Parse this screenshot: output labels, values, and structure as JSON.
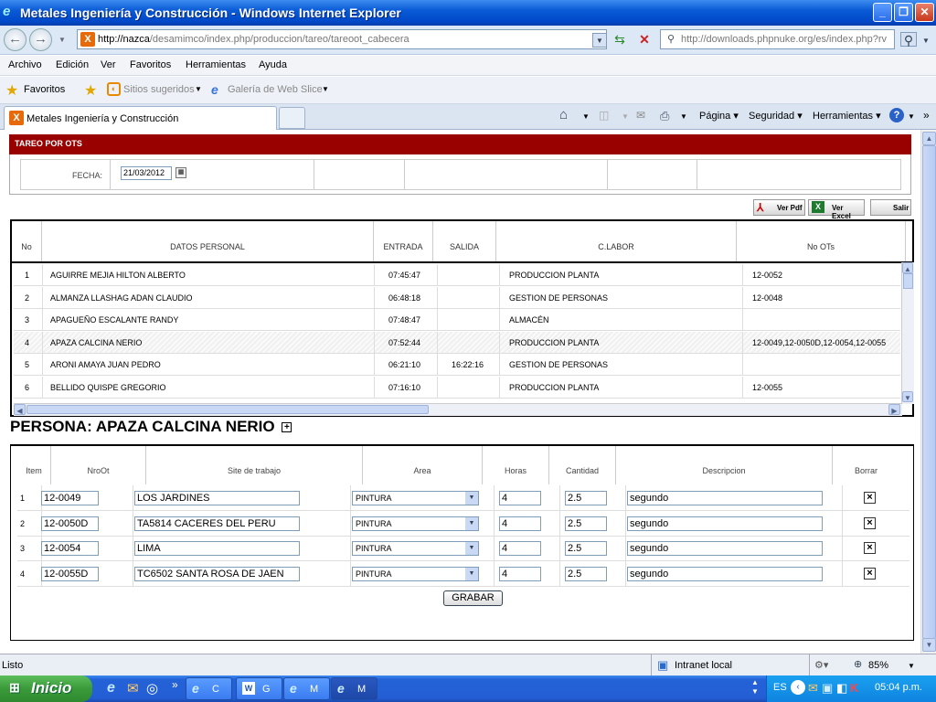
{
  "window": {
    "title": "Metales Ingeniería y Construcción - Windows Internet Explorer"
  },
  "address": {
    "url_host": "http://nazca",
    "url_path": "/desamimco/index.php/produccion/tareo/tareoot_cabecera",
    "search_url": "http://downloads.phpnuke.org/es/index.php?rv"
  },
  "menu": [
    "Archivo",
    "Edición",
    "Ver",
    "Favoritos",
    "Herramientas",
    "Ayuda"
  ],
  "favbar": {
    "favorites": "Favoritos",
    "suggested": "Sitios sugeridos",
    "gallery": "Galería de Web Slice"
  },
  "tab": {
    "title": "Metales Ingeniería y Construcción"
  },
  "toolbar": {
    "page": "Página",
    "security": "Seguridad",
    "tools": "Herramientas"
  },
  "page": {
    "header": "TAREO POR OTS",
    "fecha_label": "FECHA:",
    "fecha_value": "21/03/2012",
    "btn_pdf": "Ver Pdf",
    "btn_excel": "Ver Excel",
    "btn_salir": "Salir",
    "grid1_headers": [
      "No",
      "DATOS PERSONAL",
      "ENTRADA",
      "SALIDA",
      "C.LABOR",
      "No OTs"
    ],
    "personal": [
      {
        "no": "1",
        "nombre": "AGUIRRE MEJIA HILTON ALBERTO",
        "entrada": "07:45:47",
        "salida": "",
        "labor": "PRODUCCION PLANTA",
        "ots": "12-0052"
      },
      {
        "no": "2",
        "nombre": "ALMANZA LLASHAG ADAN CLAUDIO",
        "entrada": "06:48:18",
        "salida": "",
        "labor": "GESTION DE PERSONAS",
        "ots": "12-0048"
      },
      {
        "no": "3",
        "nombre": "APAGUEÑO ESCALANTE RANDY",
        "entrada": "07:48:47",
        "salida": "",
        "labor": "ALMACÉN",
        "ots": ""
      },
      {
        "no": "4",
        "nombre": "APAZA CALCINA NERIO",
        "entrada": "07:52:44",
        "salida": "",
        "labor": "PRODUCCION PLANTA",
        "ots": "12-0049,12-0050D,12-0054,12-0055"
      },
      {
        "no": "5",
        "nombre": "ARONI AMAYA JUAN PEDRO",
        "entrada": "06:21:10",
        "salida": "16:22:16",
        "labor": "GESTION DE PERSONAS",
        "ots": ""
      },
      {
        "no": "6",
        "nombre": "BELLIDO QUISPE GREGORIO",
        "entrada": "07:16:10",
        "salida": "",
        "labor": "PRODUCCION PLANTA",
        "ots": "12-0055"
      }
    ],
    "persona_title": "PERSONA: APAZA CALCINA NERIO",
    "grid2_headers": [
      "Item",
      "NroOt",
      "Site de trabajo",
      "Area",
      "Horas",
      "Cantidad",
      "Descripcion",
      "Borrar"
    ],
    "ots": [
      {
        "item": "1",
        "nro": "12-0049",
        "site": "LOS JARDINES",
        "area": "PINTURA",
        "horas": "4",
        "cantidad": "2.5",
        "desc": "segundo"
      },
      {
        "item": "2",
        "nro": "12-0050D",
        "site": "TA5814 CACERES DEL PERU",
        "area": "PINTURA",
        "horas": "4",
        "cantidad": "2.5",
        "desc": "segundo"
      },
      {
        "item": "3",
        "nro": "12-0054",
        "site": "LIMA",
        "area": "PINTURA",
        "horas": "4",
        "cantidad": "2.5",
        "desc": "segundo"
      },
      {
        "item": "4",
        "nro": "12-0055D",
        "site": "TC6502  SANTA ROSA DE JAEN",
        "area": "PINTURA",
        "horas": "4",
        "cantidad": "2.5",
        "desc": "segundo"
      }
    ],
    "grabar": "GRABAR"
  },
  "status": {
    "text": "Listo",
    "zone": "Intranet local",
    "zoom": "85%"
  },
  "taskbar": {
    "start": "Inicio",
    "buttons": [
      "C",
      "G",
      "M",
      "M"
    ],
    "lang": "ES",
    "clock": "05:04 p.m."
  }
}
